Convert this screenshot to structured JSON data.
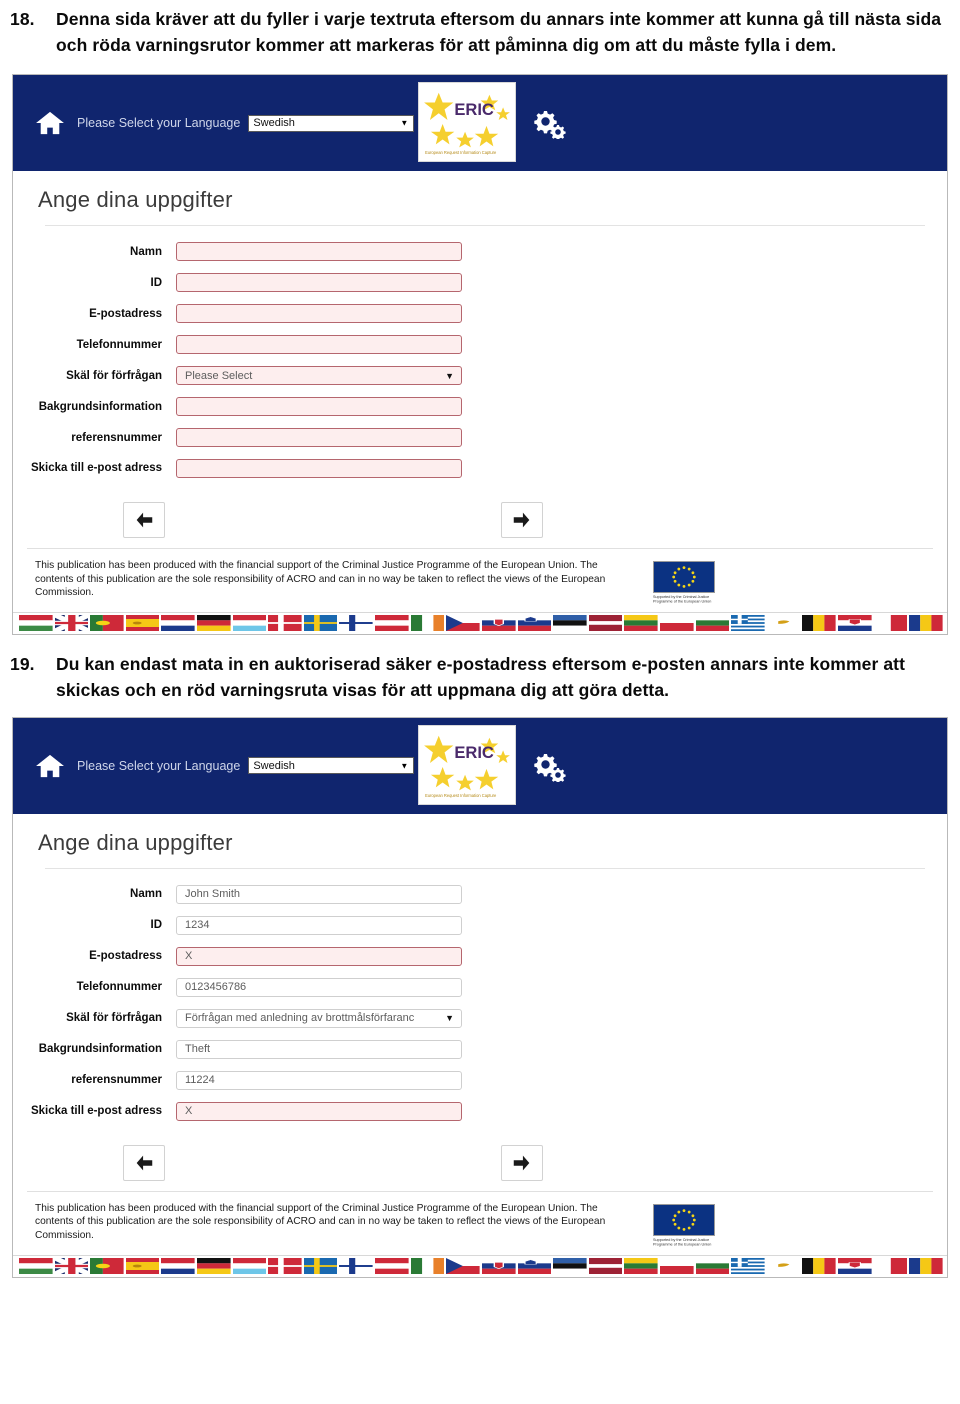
{
  "document": {
    "items": [
      {
        "number": "18.",
        "text": "Denna sida kräver att du fyller i varje textruta eftersom du annars inte kommer att kunna gå till nästa sida och röda varningsrutor kommer att markeras för att påminna dig om att du måste fylla i dem."
      },
      {
        "number": "19.",
        "text": "Du kan endast mata in en auktoriserad säker e-postadress eftersom e-posten annars inte kommer att skickas och en röd varningsruta visas för att uppmana dig att göra detta."
      }
    ]
  },
  "screenshots": [
    {
      "header": {
        "language_label": "Please Select your Language",
        "language_value": "Swedish",
        "logo_title": "ERIC",
        "logo_subtitle": "European Request Information Capture",
        "home_icon": "home-icon",
        "gears_icon": "gears-icon",
        "background_color": "#10256e"
      },
      "form": {
        "title": "Ange dina uppgifter",
        "fields": [
          {
            "label": "Namn",
            "value": "",
            "type": "text",
            "error": true
          },
          {
            "label": "ID",
            "value": "",
            "type": "text",
            "error": true
          },
          {
            "label": "E-postadress",
            "value": "",
            "type": "text",
            "error": true
          },
          {
            "label": "Telefonnummer",
            "value": "",
            "type": "text",
            "error": true
          },
          {
            "label": "Skäl för förfrågan",
            "value": "Please Select",
            "type": "select",
            "error": true
          },
          {
            "label": "Bakgrundsinformation",
            "value": "",
            "type": "text",
            "error": true
          },
          {
            "label": "referensnummer",
            "value": "",
            "type": "text",
            "error": true
          },
          {
            "label": "Skicka till e-post adress",
            "value": "",
            "type": "text",
            "error": true
          }
        ],
        "back_button": "back-arrow",
        "next_button": "next-arrow"
      },
      "footer": {
        "text": "This publication has been produced with the financial support of the Criminal Justice Programme of the European Union. The contents of this publication are the sole responsibility of ACRO and can in no way be taken to reflect the views of the European Commission.",
        "eu_caption": "Supported by the Criminal Justice Programme of the European Union"
      }
    },
    {
      "header": {
        "language_label": "Please Select your Language",
        "language_value": "Swedish",
        "logo_title": "ERIC",
        "logo_subtitle": "European Request Information Capture",
        "home_icon": "home-icon",
        "gears_icon": "gears-icon",
        "background_color": "#10256e"
      },
      "form": {
        "title": "Ange dina uppgifter",
        "fields": [
          {
            "label": "Namn",
            "value": "John Smith",
            "type": "text",
            "error": false
          },
          {
            "label": "ID",
            "value": "1234",
            "type": "text",
            "error": false
          },
          {
            "label": "E-postadress",
            "value": "X",
            "type": "text",
            "error": true
          },
          {
            "label": "Telefonnummer",
            "value": "0123456786",
            "type": "text",
            "error": false
          },
          {
            "label": "Skäl för förfrågan",
            "value": "Förfrågan med anledning av brottmålsförfaranc",
            "type": "select",
            "error": false
          },
          {
            "label": "Bakgrundsinformation",
            "value": "Theft",
            "type": "text",
            "error": false
          },
          {
            "label": "referensnummer",
            "value": "11224",
            "type": "text",
            "error": false
          },
          {
            "label": "Skicka till e-post adress",
            "value": "X",
            "type": "text",
            "error": true
          }
        ],
        "back_button": "back-arrow",
        "next_button": "next-arrow"
      },
      "footer": {
        "text": "This publication has been produced with the financial support of the Criminal Justice Programme of the European Union. The contents of this publication are the sole responsibility of ACRO and can in no way be taken to reflect the views of the European Commission.",
        "eu_caption": "Supported by the Criminal Justice Programme of the European Union"
      }
    }
  ],
  "flags": [
    "Hungary",
    "United Kingdom",
    "Portugal",
    "Spain",
    "Netherlands",
    "Germany",
    "Luxembourg",
    "Denmark",
    "Sweden",
    "Finland",
    "Austria",
    "Ireland",
    "Czech Republic",
    "Slovakia",
    "Slovenia",
    "Estonia",
    "Latvia",
    "Lithuania",
    "Poland",
    "Bulgaria",
    "Greece",
    "Cyprus",
    "Belgium",
    "Croatia",
    "Malta",
    "Romania"
  ],
  "colors": {
    "header_navy": "#10256e",
    "error_border": "#b5666e",
    "error_fill": "#fdeeee",
    "logo_star": "#f5cf2e",
    "logo_text": "#4a2a6b"
  }
}
